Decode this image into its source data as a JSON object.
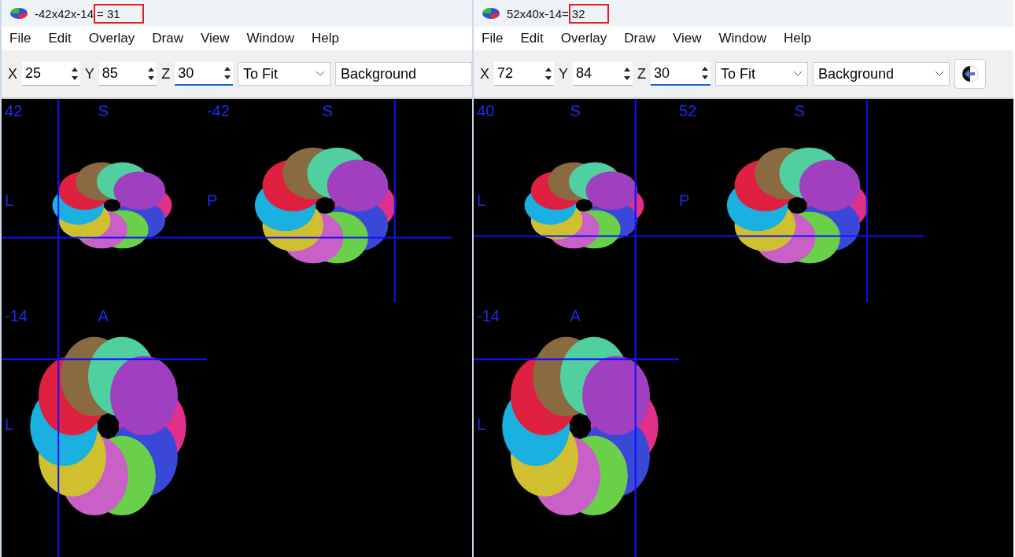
{
  "windows": [
    {
      "title": "-42x42x-14",
      "title_marked": "= 31",
      "menu": [
        "File",
        "Edit",
        "Overlay",
        "Draw",
        "View",
        "Window",
        "Help"
      ],
      "fields": [
        {
          "label": "X",
          "value": "25",
          "focused": false
        },
        {
          "label": "Y",
          "value": "85",
          "focused": false
        },
        {
          "label": "Z",
          "value": "30",
          "focused": true
        }
      ],
      "zoom": "To Fit",
      "layer": "Background",
      "back_button": false,
      "views": [
        {
          "kind": "coronal",
          "labels": [
            "42",
            "S",
            "L"
          ]
        },
        {
          "kind": "sagittal",
          "labels": [
            "-42",
            "S",
            "P"
          ]
        },
        {
          "kind": "axial",
          "labels": [
            "-14",
            "A",
            "L"
          ]
        }
      ]
    },
    {
      "title": "52x40x-14=",
      "title_marked": "32",
      "menu": [
        "File",
        "Edit",
        "Overlay",
        "Draw",
        "View",
        "Window",
        "Help"
      ],
      "fields": [
        {
          "label": "X",
          "value": "72",
          "focused": false
        },
        {
          "label": "Y",
          "value": "84",
          "focused": false
        },
        {
          "label": "Z",
          "value": "30",
          "focused": true
        }
      ],
      "zoom": "To Fit",
      "layer": "Background",
      "back_button": true,
      "views": [
        {
          "kind": "coronal",
          "labels": [
            "40",
            "S",
            "L"
          ]
        },
        {
          "kind": "sagittal",
          "labels": [
            "52",
            "S",
            "P"
          ]
        },
        {
          "kind": "axial",
          "labels": [
            "-14",
            "A",
            "L"
          ]
        }
      ]
    }
  ]
}
